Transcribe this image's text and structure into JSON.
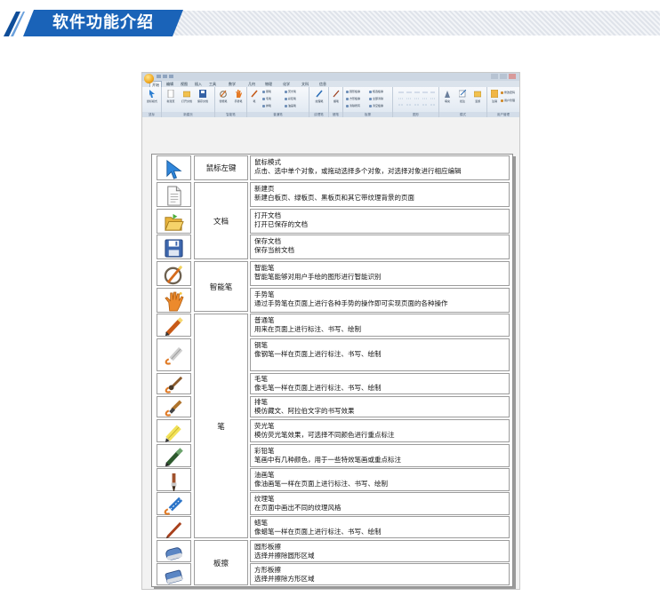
{
  "page": {
    "section_title": "软件功能介绍"
  },
  "app": {
    "title": "",
    "tabs": [
      {
        "label": "开始",
        "active": true
      },
      {
        "label": "编辑"
      },
      {
        "label": "视图"
      },
      {
        "label": "插入"
      },
      {
        "label": "工具"
      },
      {
        "label": "数学"
      },
      {
        "label": "几何"
      },
      {
        "label": "物理"
      },
      {
        "label": "化学"
      },
      {
        "label": "文科"
      },
      {
        "label": "信息"
      }
    ],
    "ribbon": {
      "groups": [
        {
          "label": "鼠标",
          "buttons": [
            "鼠标模式"
          ]
        },
        {
          "label": "新建页",
          "buttons": [
            "新建页",
            "打开文档",
            "保存文档"
          ]
        },
        {
          "label": "智能笔",
          "buttons": [
            "智能笔",
            "手势笔"
          ]
        },
        {
          "label": "普通笔",
          "buttons": [
            "笔"
          ],
          "small": [
            "钢笔",
            "毛笔",
            "排笔",
            "荧光笔",
            "彩铅笔",
            "油画笔"
          ]
        },
        {
          "label": "纹理笔",
          "buttons": [
            "纹理笔"
          ]
        },
        {
          "label": "蜡笔",
          "buttons": [
            "蜡笔"
          ]
        },
        {
          "label": "板擦",
          "small": [
            "圆形板擦",
            "方形板擦",
            "清除所有",
            "框选板擦",
            "全部清除",
            "清空板擦"
          ]
        },
        {
          "label": "图形",
          "buttons": []
        },
        {
          "label": "模式",
          "buttons": [
            "填充",
            "批注",
            "漫游"
          ]
        },
        {
          "label": "用户管理",
          "buttons": [
            "注销"
          ],
          "small": [
            "修改密码",
            "用户管理"
          ]
        }
      ]
    }
  },
  "features": {
    "rows": [
      {
        "icon": "cursor-arrow-icon",
        "title": "鼠标模式",
        "desc": "点击、选中单个对象，或拖动选择多个对象，对选择对象进行相应编辑"
      },
      {
        "icon": "new-page-icon",
        "title": "新建页",
        "desc": "新建白板页、绿板页、黑板页和其它带纹理背景的页面"
      },
      {
        "icon": "open-folder-icon",
        "title": "打开文档",
        "desc": "打开已保存的文档"
      },
      {
        "icon": "save-disk-icon",
        "title": "保存文档",
        "desc": "保存当前文档"
      },
      {
        "icon": "smart-pen-icon",
        "title": "智能笔",
        "desc": "智能笔能够对用户手绘的图形进行智能识别"
      },
      {
        "icon": "gesture-hand-icon",
        "title": "手势笔",
        "desc": "通过手势笔在页面上进行各种手势的操作即可实现页面的各种操作"
      },
      {
        "icon": "pencil-icon",
        "title": "普通笔",
        "desc": "用来在页面上进行标注、书写、绘制"
      },
      {
        "icon": "fountain-pen-icon",
        "title": "钢笔",
        "desc": "像钢笔一样在页面上进行标注、书写、绘制"
      },
      {
        "icon": "brush-icon",
        "title": "毛笔",
        "desc": "像毛笔一样在页面上进行标注、书写、绘制"
      },
      {
        "icon": "flat-brush-icon",
        "title": "排笔",
        "desc": "模仿藏文、阿拉伯文字的书写效果"
      },
      {
        "icon": "highlighter-icon",
        "title": "荧光笔",
        "desc": "模仿荧光笔效果，可选择不同颜色进行重点标注"
      },
      {
        "icon": "color-pencil-icon",
        "title": "彩铅笔",
        "desc": "笔画中有几种颜色，用于一些特效笔画或重点标注"
      },
      {
        "icon": "oil-brush-icon",
        "title": "油画笔",
        "desc": "像油画笔一样在页面上进行标注、书写、绘制"
      },
      {
        "icon": "texture-pen-icon",
        "title": "纹理笔",
        "desc": "在页面中画出不同的纹理风格"
      },
      {
        "icon": "crayon-icon",
        "title": "蜡笔",
        "desc": "像蜡笔一样在页面上进行标注、书写、绘制"
      },
      {
        "icon": "round-eraser-icon",
        "title": "圆形板擦",
        "desc": "选择并擦除圆形区域"
      },
      {
        "icon": "square-eraser-icon",
        "title": "方形板擦",
        "desc": "选择并擦除方形区域"
      }
    ],
    "categories": [
      {
        "label": "鼠标左键"
      },
      {
        "label": "文档"
      },
      {
        "label": "智能笔"
      },
      {
        "label": "笔"
      },
      {
        "label": "板擦"
      }
    ]
  },
  "colors": {
    "header_blue": "#1a63b8",
    "border": "#9c9c9c"
  }
}
